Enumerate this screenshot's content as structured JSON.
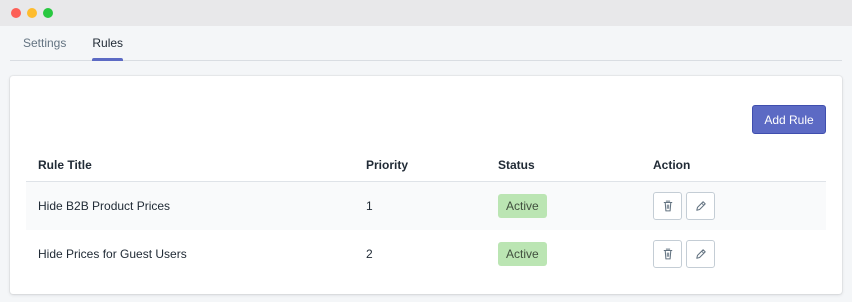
{
  "tabs": [
    {
      "label": "Settings",
      "active": false
    },
    {
      "label": "Rules",
      "active": true
    }
  ],
  "toolbar": {
    "add_label": "Add Rule"
  },
  "table": {
    "headers": {
      "title": "Rule Title",
      "priority": "Priority",
      "status": "Status",
      "action": "Action"
    },
    "rows": [
      {
        "title": "Hide B2B Product Prices",
        "priority": "1",
        "status": "Active"
      },
      {
        "title": "Hide Prices for Guest Users",
        "priority": "2",
        "status": "Active"
      }
    ]
  },
  "icons": {
    "delete": "trash-icon",
    "edit": "pencil-icon"
  },
  "colors": {
    "accent": "#5c6ac4",
    "status_active_bg": "#bbe5b3"
  }
}
